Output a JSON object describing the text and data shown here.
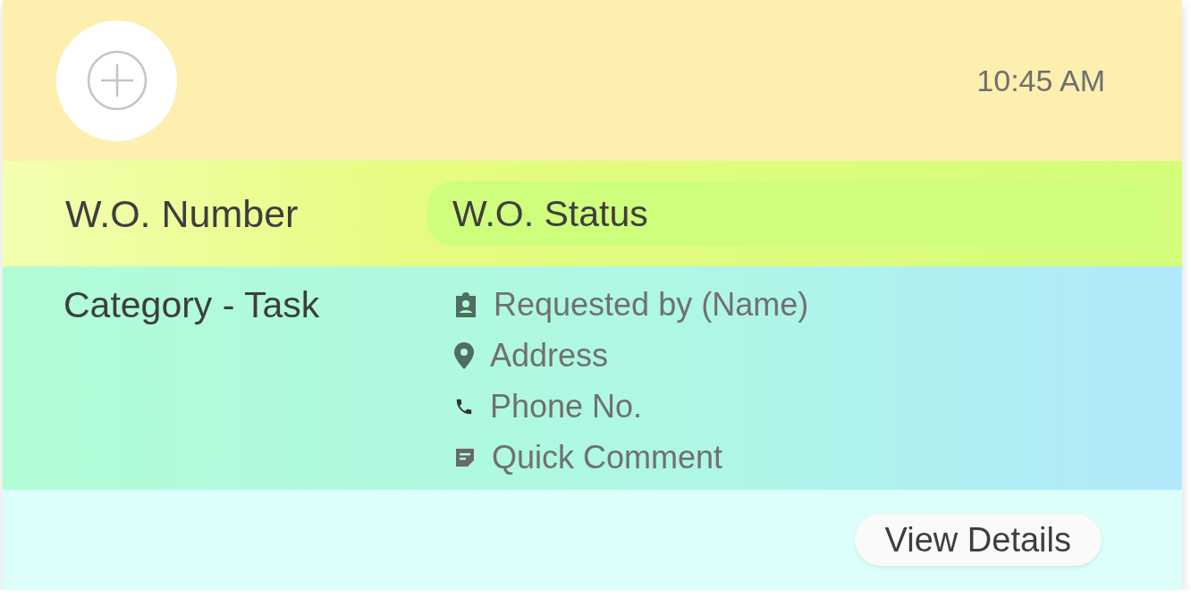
{
  "header": {
    "time": "10:45 AM"
  },
  "summary": {
    "number": "W.O. Number",
    "status": "W.O. Status"
  },
  "body": {
    "category": "Category - Task",
    "details": [
      {
        "kind": "person",
        "text": "Requested by (Name)"
      },
      {
        "kind": "location",
        "text": "Address"
      },
      {
        "kind": "phone",
        "text": "Phone No."
      },
      {
        "kind": "comment",
        "text": "Quick Comment"
      }
    ]
  },
  "footer": {
    "button": "View Details"
  }
}
